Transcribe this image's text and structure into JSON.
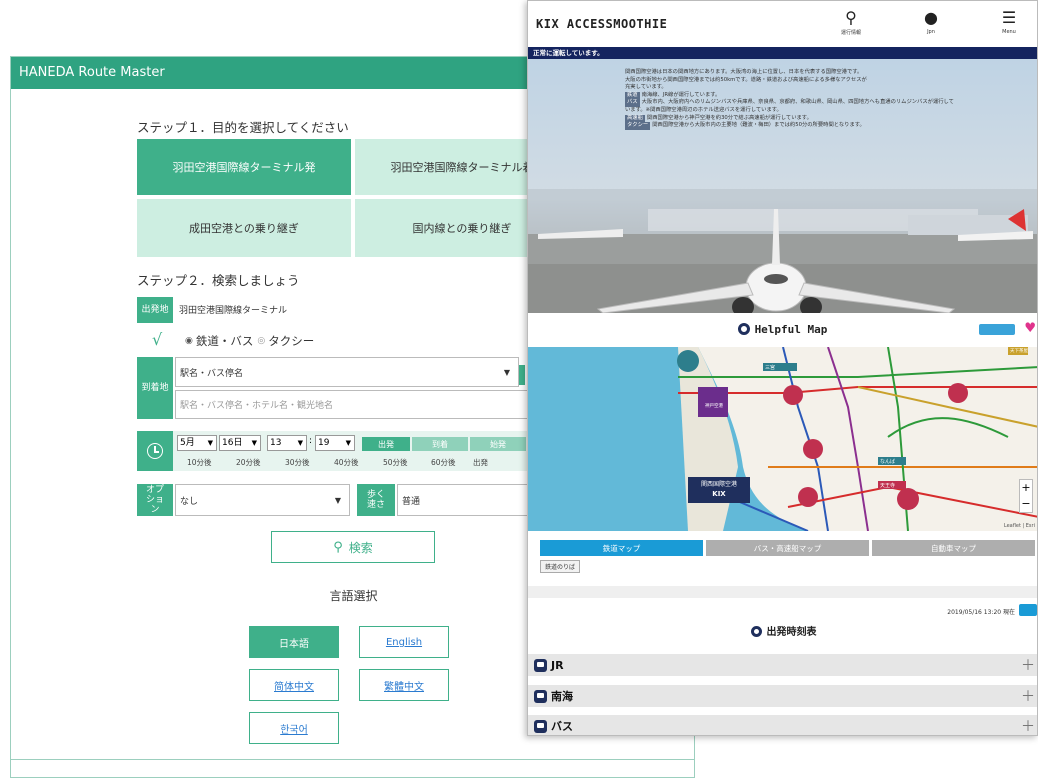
{
  "haneda": {
    "title": "HANEDA Route Master",
    "step1": "ステップ１．目的を選択してください",
    "purposes": [
      "羽田空港国際線ターミナル発",
      "羽田空港国際線ターミナル着",
      "成田空港との乗り継ぎ",
      "国内線との乗り継ぎ"
    ],
    "step2": "ステップ２．検索しましょう",
    "origin_label": "出発地",
    "origin_value": "羽田空港国際線ターミナル",
    "mode_options": [
      "鉄道・バス",
      "タクシー"
    ],
    "dest_label": "到着地",
    "dest_select": "駅名・バス停名",
    "dest_placeholder": "駅名・バス停名・ホテル名・観光地名",
    "time": {
      "month": "5月",
      "day": "16日",
      "hour": "13",
      "minute": "19",
      "time_sep": ":"
    },
    "time_types": [
      "出発",
      "到着",
      "始発"
    ],
    "after_options": [
      "10分後",
      "20分後",
      "30分後",
      "40分後",
      "50分後",
      "60分後",
      "出発"
    ],
    "option_label": "オプション",
    "option_value": "なし",
    "walk_label": "歩く速さ",
    "walk_value": "普通",
    "search_label": "検索",
    "lang_title": "言語選択",
    "languages": [
      "日本語",
      "English",
      "简体中文",
      "繁體中文",
      "한국어"
    ]
  },
  "kix": {
    "logo": "KIX ACCESSMOOTHIE",
    "header_icons": [
      {
        "icon": "pin-icon",
        "label": "運行情報"
      },
      {
        "icon": "globe-icon",
        "label": "Jpn"
      },
      {
        "icon": "menu-icon",
        "label": "Menu"
      }
    ],
    "status": "正常に運転しています。",
    "info_lines": [
      "関西国際空港は日本の関西地方にあります。大阪湾の海上に位置し、日本を代表する国際空港です。",
      "大阪の市街地から関西国際空港までは約50kmです。道路・鉄道および高速船による多様なアクセスが",
      "充実しています。"
    ],
    "info_items": [
      {
        "tag": "鉄道",
        "text": "南海線、JR線が運行しています。"
      },
      {
        "tag": "バス",
        "text": "大阪市内、大阪府内へのリムジンバスや兵庫県、奈良県、京都府、和歌山県、岡山県、四国地方へも直通のリムジンバスが運行しています。※関西国際空港周辺のホテル送迎バスを運行しています。"
      },
      {
        "tag": "高速船",
        "text": "関西国際空港から神戸空港を約30分で結ぶ高速船が運行しています。"
      },
      {
        "tag": "タクシー",
        "text": "関西国際空港から大阪市内の主要地（難波・梅田）までは約50分の所要時間となります。"
      }
    ],
    "helpful_map": "Helpful Map",
    "map_labels": {
      "kobe": "神戸空港",
      "kansai": "関西国際空港",
      "kix": "KIX",
      "tenga": "天下茶屋",
      "sannomiya": "三宮",
      "namba": "なんば",
      "tennoji": "天王寺",
      "leaflet": "Leaflet | Esri",
      "zoom_in": "+",
      "zoom_out": "−"
    },
    "map_tabs": [
      "鉄道マップ",
      "バス・高速船マップ",
      "自動車マップ"
    ],
    "rail_platform": "鉄道のりば",
    "timestamp": "2019/05/16 13:20 現在",
    "departures_title": "出発時刻表",
    "lines": [
      "JR",
      "南海",
      "バス"
    ]
  }
}
